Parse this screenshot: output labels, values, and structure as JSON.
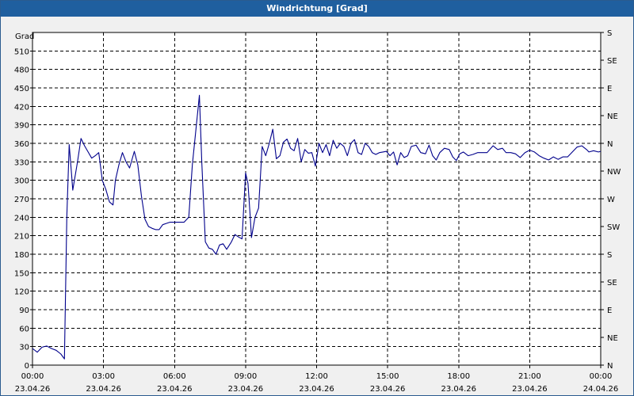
{
  "window": {
    "title": "Windrichtung [Grad]"
  },
  "chart_data": {
    "type": "line",
    "title": "Windrichtung [Grad]",
    "ylabel": "Grad",
    "ylim": [
      0,
      540
    ],
    "xlim_hours": [
      0,
      24
    ],
    "yticks": [
      0,
      30,
      60,
      90,
      120,
      150,
      180,
      210,
      240,
      270,
      300,
      330,
      360,
      390,
      420,
      450,
      480,
      510
    ],
    "y2_ticks": [
      {
        "value": 0,
        "label": "N"
      },
      {
        "value": 45,
        "label": "NE"
      },
      {
        "value": 90,
        "label": "E"
      },
      {
        "value": 135,
        "label": "SE"
      },
      {
        "value": 180,
        "label": "S"
      },
      {
        "value": 225,
        "label": "SW"
      },
      {
        "value": 270,
        "label": "W"
      },
      {
        "value": 315,
        "label": "NW"
      },
      {
        "value": 360,
        "label": "N"
      },
      {
        "value": 405,
        "label": "NE"
      },
      {
        "value": 450,
        "label": "E"
      },
      {
        "value": 495,
        "label": "SE"
      },
      {
        "value": 540,
        "label": "S"
      }
    ],
    "xticks": [
      {
        "hour": 0,
        "time": "00:00",
        "date": "23.04.26"
      },
      {
        "hour": 3,
        "time": "03:00",
        "date": "23.04.26"
      },
      {
        "hour": 6,
        "time": "06:00",
        "date": "23.04.26"
      },
      {
        "hour": 9,
        "time": "09:00",
        "date": "23.04.26"
      },
      {
        "hour": 12,
        "time": "12:00",
        "date": "23.04.26"
      },
      {
        "hour": 15,
        "time": "15:00",
        "date": "23.04.26"
      },
      {
        "hour": 18,
        "time": "18:00",
        "date": "23.04.26"
      },
      {
        "hour": 21,
        "time": "21:00",
        "date": "23.04.26"
      },
      {
        "hour": 24,
        "time": "00:00",
        "date": "24.04.26"
      }
    ],
    "grid": true,
    "series": [
      {
        "color": "#00008b",
        "points": [
          [
            0.0,
            27
          ],
          [
            0.2,
            21
          ],
          [
            0.4,
            29
          ],
          [
            0.6,
            31
          ],
          [
            0.8,
            27
          ],
          [
            1.0,
            24
          ],
          [
            1.2,
            18
          ],
          [
            1.35,
            10
          ],
          [
            1.45,
            240
          ],
          [
            1.55,
            358
          ],
          [
            1.65,
            310
          ],
          [
            1.7,
            284
          ],
          [
            1.9,
            330
          ],
          [
            2.05,
            368
          ],
          [
            2.2,
            356
          ],
          [
            2.35,
            346
          ],
          [
            2.5,
            336
          ],
          [
            2.65,
            340
          ],
          [
            2.8,
            345
          ],
          [
            2.95,
            300
          ],
          [
            3.1,
            285
          ],
          [
            3.25,
            265
          ],
          [
            3.4,
            260
          ],
          [
            3.5,
            300
          ],
          [
            3.65,
            325
          ],
          [
            3.8,
            345
          ],
          [
            3.95,
            330
          ],
          [
            4.1,
            320
          ],
          [
            4.3,
            347
          ],
          [
            4.45,
            325
          ],
          [
            4.6,
            275
          ],
          [
            4.75,
            237
          ],
          [
            4.9,
            225
          ],
          [
            5.05,
            222
          ],
          [
            5.2,
            220
          ],
          [
            5.35,
            220
          ],
          [
            5.5,
            228
          ],
          [
            5.65,
            230
          ],
          [
            5.8,
            232
          ],
          [
            6.0,
            232
          ],
          [
            6.2,
            232
          ],
          [
            6.4,
            232
          ],
          [
            6.6,
            240
          ],
          [
            6.75,
            325
          ],
          [
            6.95,
            400
          ],
          [
            7.05,
            438
          ],
          [
            7.15,
            330
          ],
          [
            7.3,
            200
          ],
          [
            7.45,
            190
          ],
          [
            7.6,
            188
          ],
          [
            7.75,
            180
          ],
          [
            7.9,
            195
          ],
          [
            8.05,
            197
          ],
          [
            8.2,
            188
          ],
          [
            8.4,
            200
          ],
          [
            8.55,
            212
          ],
          [
            8.7,
            208
          ],
          [
            8.85,
            205
          ],
          [
            9.0,
            312
          ],
          [
            9.1,
            295
          ],
          [
            9.2,
            240
          ],
          [
            9.25,
            207
          ],
          [
            9.4,
            240
          ],
          [
            9.55,
            255
          ],
          [
            9.7,
            355
          ],
          [
            9.85,
            340
          ],
          [
            10.0,
            360
          ],
          [
            10.15,
            383
          ],
          [
            10.3,
            335
          ],
          [
            10.45,
            340
          ],
          [
            10.6,
            362
          ],
          [
            10.75,
            367
          ],
          [
            10.9,
            352
          ],
          [
            11.05,
            348
          ],
          [
            11.2,
            368
          ],
          [
            11.35,
            330
          ],
          [
            11.5,
            350
          ],
          [
            11.65,
            344
          ],
          [
            11.8,
            345
          ],
          [
            11.95,
            323
          ],
          [
            12.1,
            360
          ],
          [
            12.25,
            345
          ],
          [
            12.4,
            358
          ],
          [
            12.55,
            340
          ],
          [
            12.7,
            365
          ],
          [
            12.85,
            352
          ],
          [
            13.0,
            360
          ],
          [
            13.15,
            355
          ],
          [
            13.3,
            340
          ],
          [
            13.45,
            360
          ],
          [
            13.6,
            366
          ],
          [
            13.75,
            345
          ],
          [
            13.9,
            342
          ],
          [
            14.05,
            360
          ],
          [
            14.2,
            355
          ],
          [
            14.35,
            345
          ],
          [
            14.5,
            342
          ],
          [
            14.65,
            345
          ],
          [
            14.8,
            346
          ],
          [
            14.95,
            347
          ],
          [
            15.1,
            340
          ],
          [
            15.25,
            346
          ],
          [
            15.4,
            325
          ],
          [
            15.55,
            345
          ],
          [
            15.7,
            337
          ],
          [
            15.85,
            340
          ],
          [
            16.0,
            355
          ],
          [
            16.2,
            357
          ],
          [
            16.4,
            345
          ],
          [
            16.6,
            343
          ],
          [
            16.75,
            357
          ],
          [
            16.9,
            340
          ],
          [
            17.05,
            333
          ],
          [
            17.2,
            345
          ],
          [
            17.4,
            352
          ],
          [
            17.6,
            350
          ],
          [
            17.75,
            338
          ],
          [
            17.9,
            332
          ],
          [
            18.05,
            343
          ],
          [
            18.2,
            346
          ],
          [
            18.4,
            340
          ],
          [
            18.6,
            342
          ],
          [
            18.8,
            345
          ],
          [
            19.0,
            345
          ],
          [
            19.2,
            345
          ],
          [
            19.45,
            356
          ],
          [
            19.65,
            350
          ],
          [
            19.85,
            352
          ],
          [
            20.0,
            345
          ],
          [
            20.2,
            345
          ],
          [
            20.4,
            343
          ],
          [
            20.6,
            337
          ],
          [
            20.8,
            345
          ],
          [
            21.0,
            349
          ],
          [
            21.2,
            346
          ],
          [
            21.4,
            340
          ],
          [
            21.6,
            336
          ],
          [
            21.8,
            333
          ],
          [
            22.0,
            338
          ],
          [
            22.2,
            334
          ],
          [
            22.4,
            338
          ],
          [
            22.6,
            338
          ],
          [
            22.8,
            346
          ],
          [
            23.0,
            354
          ],
          [
            23.2,
            356
          ],
          [
            23.4,
            350
          ],
          [
            23.5,
            346
          ],
          [
            23.7,
            348
          ],
          [
            23.9,
            346
          ],
          [
            24.0,
            347
          ]
        ]
      }
    ]
  }
}
